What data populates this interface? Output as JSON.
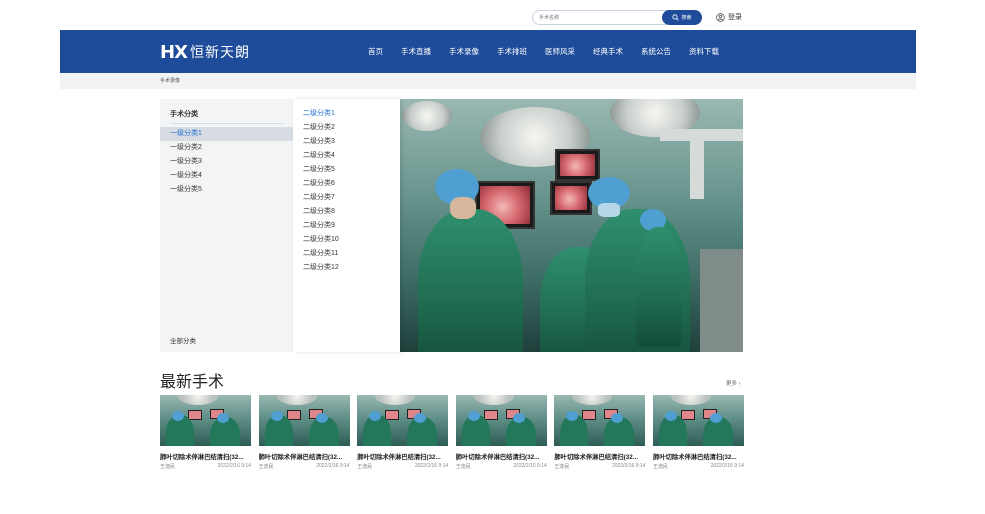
{
  "topbar": {
    "search_placeholder": "手术名称",
    "search_button": "搜索",
    "login": "登录"
  },
  "header": {
    "logo_mark": "HX",
    "logo_text": "恒新天朗",
    "nav": [
      "首页",
      "手术直播",
      "手术录像",
      "手术排班",
      "医师风采",
      "经典手术",
      "系统公告",
      "资料下载"
    ]
  },
  "breadcrumb": "手术录像",
  "categories": {
    "title": "手术分类",
    "items": [
      "一级分类1",
      "一级分类2",
      "一级分类3",
      "一级分类4",
      "一级分类5"
    ],
    "all_label": "全部分类",
    "sub_items": [
      "二级分类1",
      "二级分类2",
      "二级分类3",
      "二级分类4",
      "二级分类5",
      "二级分类6",
      "二级分类7",
      "二级分类8",
      "二级分类9",
      "二级分类10",
      "二级分类11",
      "二级分类12"
    ]
  },
  "latest": {
    "title": "最新手术",
    "more": "更多 ›",
    "cards": [
      {
        "title": "肺叶切除术伴淋巴结清扫(32...",
        "author": "王逸民",
        "date": "2022/2/16  9:14"
      },
      {
        "title": "肺叶切除术伴淋巴结清扫(32...",
        "author": "王逸民",
        "date": "2022/2/16  9:14"
      },
      {
        "title": "肺叶切除术伴淋巴结清扫(32...",
        "author": "王逸民",
        "date": "2022/2/16  9:14"
      },
      {
        "title": "肺叶切除术伴淋巴结清扫(32...",
        "author": "王逸民",
        "date": "2022/2/16  9:14"
      },
      {
        "title": "肺叶切除术伴淋巴结清扫(32...",
        "author": "王逸民",
        "date": "2022/2/16  9:14"
      },
      {
        "title": "肺叶切除术伴淋巴结清扫(32...",
        "author": "王逸民",
        "date": "2022/2/16  9:14"
      }
    ]
  },
  "colors": {
    "brand": "#1e4c9a",
    "active_link": "#1e6fd0",
    "panel_bg": "#f3f4f6"
  },
  "icons": {
    "search": "search-icon",
    "user": "user-icon"
  }
}
